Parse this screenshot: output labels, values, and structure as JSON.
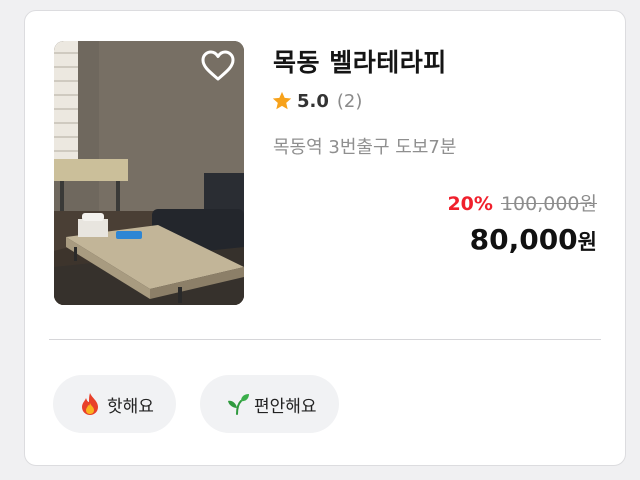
{
  "listing": {
    "name": "목동 벨라테라피",
    "rating": "5.0",
    "review_count": "(2)",
    "location": "목동역 3번출구 도보7분",
    "wishlist_icon": "heart-outline-icon"
  },
  "price": {
    "discount_rate": "20%",
    "original": "100,000원",
    "final_amount": "80,000",
    "final_unit": "원"
  },
  "tags": [
    {
      "label": "핫해요",
      "icon": "fire-icon"
    },
    {
      "label": "편안해요",
      "icon": "sprout-icon"
    }
  ],
  "colors": {
    "discount": "#f0202c",
    "star": "#f7a21b",
    "tag_bg": "#f1f2f4"
  }
}
